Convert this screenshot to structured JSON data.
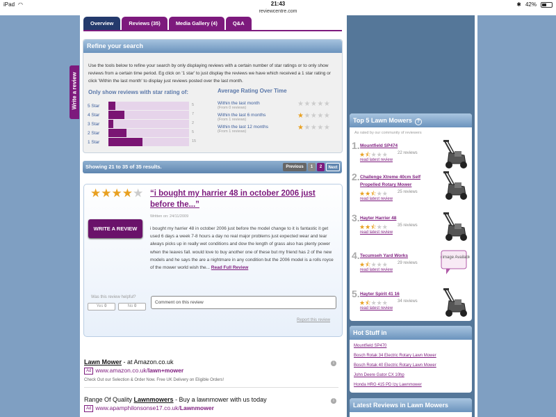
{
  "status": {
    "device": "iPad",
    "time": "21:43",
    "battery": "42%",
    "url": "reviewcentre.com"
  },
  "tabs": [
    "Overview",
    "Reviews (35)",
    "Media Gallery (4)",
    "Q&A"
  ],
  "side_tab": "Write a review",
  "refine": {
    "title": "Refine your search",
    "text": "Use the tools below to refine your search by only displaying reviews with a certain number of star ratings or to only show reviews from a certain time period. Eg click on '1 star' to just display the reviews we have which received a 1 star rating or click 'Within the last month' to display just reviews posted over the last month.",
    "star_heading": "Only show reviews with star rating of:",
    "avg_heading": "Average Rating Over Time"
  },
  "star_rows": [
    {
      "label": "5 Star",
      "count": "5",
      "fill": 0.09
    },
    {
      "label": "4 Star",
      "count": "7",
      "fill": 0.2
    },
    {
      "label": "3 Star",
      "count": "2",
      "fill": 0.06
    },
    {
      "label": "2 Star",
      "count": "5",
      "fill": 0.22
    },
    {
      "label": "1 Star",
      "count": "15",
      "fill": 0.42
    }
  ],
  "avg_rows": [
    {
      "label": "Within the last month",
      "sub": "(From 0 reviews)",
      "stars": 0
    },
    {
      "label": "Within the last 6 months",
      "sub": "(From 1 reviews)",
      "stars": 1
    },
    {
      "label": "Within the last 12 months",
      "sub": "(From 1 reviews)",
      "stars": 1
    }
  ],
  "pager": {
    "showing": "Showing 21 to 35 of 35 results.",
    "previous": "Previous",
    "p1": "1",
    "p2": "2",
    "next": "Next"
  },
  "review": {
    "stars": 4,
    "title": "“i bought my harrier 48 in october 2006 just before the...”",
    "date": "Written on: 24/11/2009",
    "write_btn": "WRITE A REVIEW",
    "body": "i bought my harrier 48 in october 2006 just before the model change to it is fantastic it get used 6 days a week 7-8 hours a day no real major problems just expected wear and tear always picks up in really wet conditions and dow the length of grass also has plenty power when the leaves fall. would love to buy another one of these but my friend has 2 of the new models and he says the are a nightmare in any condition but the 2006 model is a rolls royce of the mower world wish the...",
    "read_full": "Read Full Review",
    "helpful": "Was this review helpful?",
    "yes": "Yes",
    "yes_count": "0",
    "no": "No",
    "no_count": "0",
    "comment": "Comment on this review",
    "report": "Report this review"
  },
  "ads": [
    {
      "title_bold": "Lawn Mower",
      "title_rest": " - at Amazon.co.uk",
      "ad_label": "Ad",
      "url_pre": "www.amazon.co.uk/",
      "url_bold": "lawn+mower",
      "desc": "Check Out our Selection & Order Now. Free UK Delivery on Eligible Orders!"
    },
    {
      "title_pre": "Range Of Quality ",
      "title_bold": "Lawnmowers",
      "title_rest": " - Buy a lawnmower with us today",
      "ad_label": "Ad",
      "url_pre": "www.apamphilonsonse17.co.uk/",
      "url_bold": "Lawnmower"
    }
  ],
  "top5": {
    "title": "Top 5 Lawn Mowers",
    "subtitle": "As rated by our community of reviewers",
    "read_latest": "read latest review",
    "no_image": "No image Available",
    "items": [
      {
        "rank": "1.",
        "name": "Mountfield SP474",
        "stars": 1.5,
        "count": "22 reviews"
      },
      {
        "rank": "2.",
        "name": "Challenge Xtreme 40cm Self Propelled Rotary Mower",
        "stars": 2.5,
        "count": "25 reviews"
      },
      {
        "rank": "3.",
        "name": "Hayter Harrier 48",
        "stars": 2.5,
        "count": "35 reviews"
      },
      {
        "rank": "4.",
        "name": "Tecumseh Yard Works",
        "stars": 1.5,
        "count": "29 reviews"
      },
      {
        "rank": "5.",
        "name": "Hayter Spirit 41 16",
        "stars": 1.5,
        "count": "34 reviews"
      }
    ]
  },
  "hot": {
    "title": "Hot Stuff in",
    "items": [
      "Mountfield SP470",
      "Bosch Rotak 34 Electric Rotary Lawn Mower",
      "Bosch Rotak 40 Electric Rotary Lawn Mower",
      "John Deere Gator CX 10hp",
      "Honda HRG 415 PD Izy Lawnmower"
    ]
  },
  "latest": {
    "title": "Latest Reviews in Lawn Mowers"
  }
}
